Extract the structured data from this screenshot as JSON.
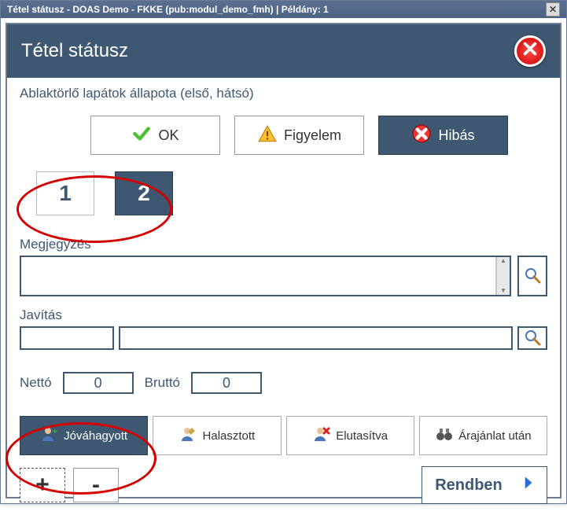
{
  "window": {
    "title": "Tétel státusz - DOAS Demo - FKKE (pub:modul_demo_fmh) | Példány: 1"
  },
  "header": {
    "title": "Tétel státusz"
  },
  "subtitle": "Ablaktörlő lapátok állapota (első, hátsó)",
  "status": {
    "ok": "OK",
    "warn": "Figyelem",
    "err": "Hibás"
  },
  "numbers": {
    "one": "1",
    "two": "2"
  },
  "labels": {
    "megjegyzes": "Megjegyzés",
    "javitas": "Javítás",
    "netto": "Nettó",
    "brutto": "Bruttó"
  },
  "values": {
    "megjegyzes": "",
    "javitas1": "",
    "javitas2": "",
    "netto": "0",
    "brutto": "0"
  },
  "tabs": {
    "approved": "Jóváhagyott",
    "deferred": "Halasztott",
    "rejected": "Elutasítva",
    "afterquote": "Árajánlat után"
  },
  "pm": {
    "plus": "+",
    "minus": "-"
  },
  "ok_button": "Rendben"
}
